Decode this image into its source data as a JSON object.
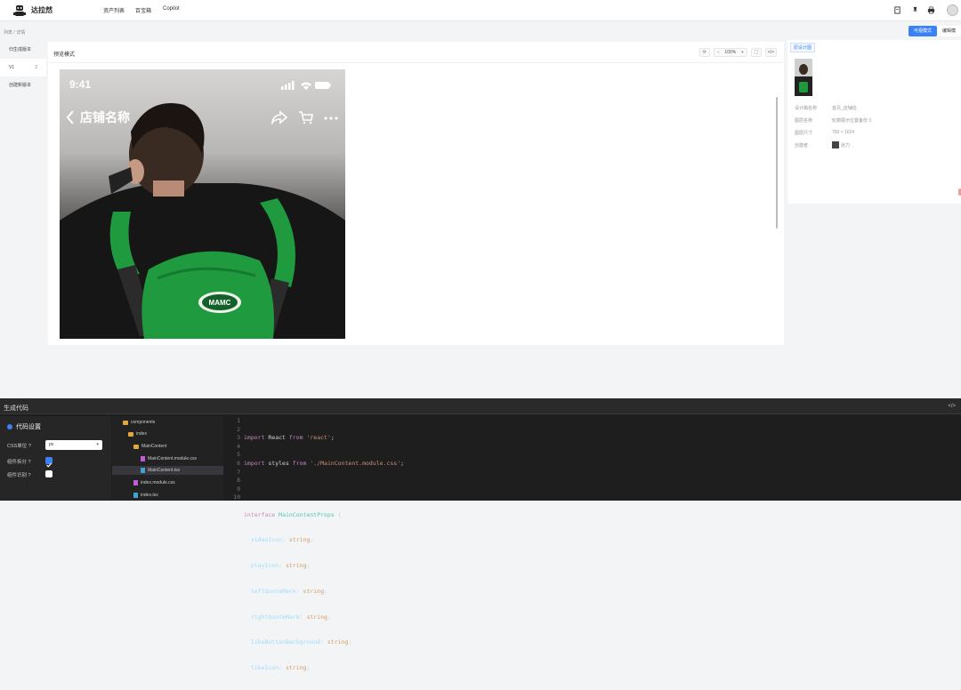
{
  "app": {
    "brand": "达拉然"
  },
  "nav": {
    "items": [
      "资产列表",
      "百宝箱",
      "Copilot"
    ]
  },
  "breadcrumb": {
    "items": [
      "列表",
      "详情"
    ],
    "sep": "/"
  },
  "modes": {
    "visual": "可视模式",
    "annotate": "编辑模"
  },
  "leftnav": {
    "items": [
      "归生成版本",
      "V1",
      "创建新版本"
    ],
    "v1_sub": "2"
  },
  "preview": {
    "title": "预览模式",
    "zoom": "100%",
    "zoom_minus": "−",
    "zoom_plus": "+",
    "phone": {
      "time": "9:41",
      "store_name": "店铺名称",
      "logo_text": "MAMC"
    }
  },
  "info": {
    "tab": "原设计图",
    "rows": [
      {
        "k": "设计稿名称",
        "v": "首页_店铺信"
      },
      {
        "k": "图层名称",
        "v": "轮廓展示位置备份 3"
      },
      {
        "k": "图层尺寸",
        "v": "750 × 1624"
      },
      {
        "k": "创建者",
        "v": "张力"
      }
    ]
  },
  "bottom": {
    "title": "生成代码",
    "code_toggle": "</>",
    "settings": {
      "title": "代码设置",
      "css_unit_label": "CSS单位",
      "css_unit_value": "px",
      "split_label": "组件拆分",
      "split_on": true,
      "detect_label": "组件识别",
      "detect_on": false,
      "help": "?"
    },
    "tree": [
      {
        "name": "components",
        "type": "folder",
        "depth": 0
      },
      {
        "name": "index",
        "type": "folder",
        "depth": 1
      },
      {
        "name": "MainContent",
        "type": "folder",
        "depth": 2
      },
      {
        "name": "MainContent.module.css",
        "type": "css",
        "depth": 3
      },
      {
        "name": "MainContent.tsx",
        "type": "tsx",
        "depth": 3
      },
      {
        "name": "index.module.css",
        "type": "css",
        "depth": 2
      },
      {
        "name": "index.tsx",
        "type": "tsx",
        "depth": 2
      }
    ],
    "code_lines": [
      "import React from 'react';",
      "import styles from './MainContent.module.css';",
      "",
      "interface MainContentProps {",
      "  videoIcon: string;",
      "  playIcon: string;",
      "  leftQuoteMark: string;",
      "  rightQuoteMark: string;",
      "  likeButtonBackground: string;",
      "  likeIcon: string;"
    ],
    "line_numbers": [
      "1",
      "2",
      "3",
      "4",
      "5",
      "6",
      "7",
      "8",
      "9",
      "10"
    ]
  },
  "colors": {
    "accent": "#3b82f6",
    "panel_dark": "#1e1e1e",
    "bag_green": "#1f9a3e"
  }
}
